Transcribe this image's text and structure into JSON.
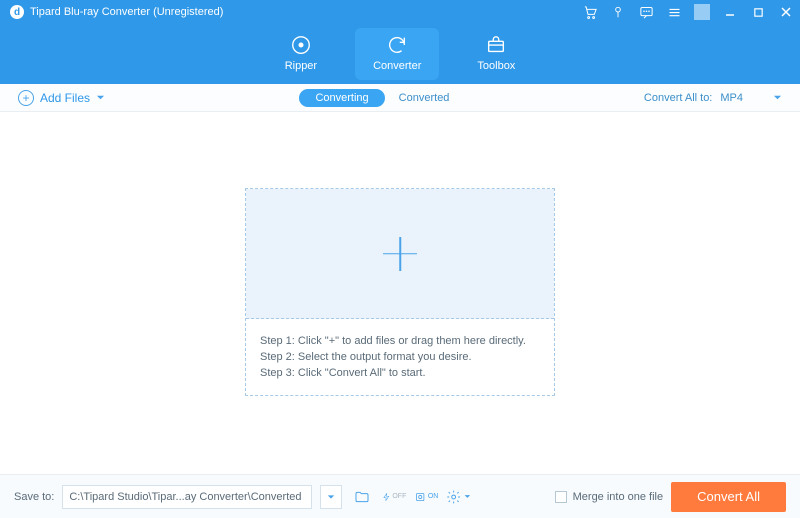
{
  "titlebar": {
    "title": "Tipard Blu-ray Converter (Unregistered)"
  },
  "nav": {
    "ripper": "Ripper",
    "converter": "Converter",
    "toolbox": "Toolbox"
  },
  "subbar": {
    "add_files": "Add Files",
    "converting": "Converting",
    "converted": "Converted",
    "convert_all_to": "Convert All to:",
    "format": "MP4"
  },
  "steps": {
    "s1": "Step 1: Click \"+\" to add files or drag them here directly.",
    "s2": "Step 2: Select the output format you desire.",
    "s3": "Step 3: Click \"Convert All\" to start."
  },
  "footer": {
    "save_to": "Save to:",
    "path": "C:\\Tipard Studio\\Tipar...ay Converter\\Converted",
    "merge": "Merge into one file",
    "convert_all": "Convert All"
  }
}
